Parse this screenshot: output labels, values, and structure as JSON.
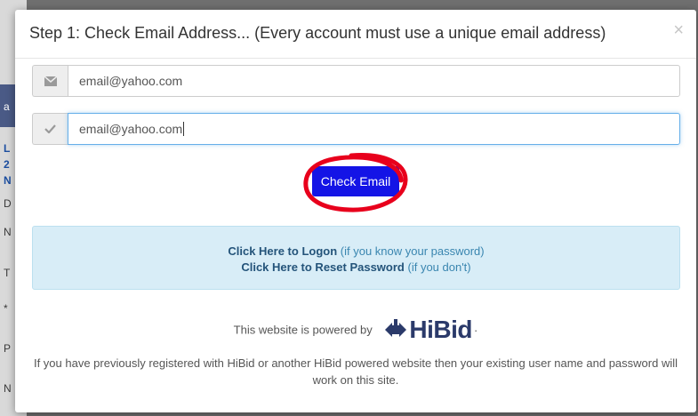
{
  "background_page": {
    "chars": [
      "a",
      "L",
      "2",
      "N",
      "D",
      "N",
      "T",
      "*",
      "P",
      "N"
    ]
  },
  "modal": {
    "title": "Step 1: Check Email Address... (Every account must use a unique email address)",
    "close_glyph": "×",
    "email_field": {
      "value": "email@yahoo.com",
      "icon": "envelope-icon"
    },
    "confirm_field": {
      "value": "email@yahoo.com",
      "icon": "check-icon"
    },
    "check_button_label": "Check Email",
    "info": {
      "logon_link": "Click Here to Logon",
      "logon_hint": "(if you know your password)",
      "reset_link": "Click Here to Reset Password",
      "reset_hint": "(if you don't)"
    },
    "powered_by": "This website is powered by",
    "brand": "HiBid",
    "footer_note": "If you have previously registered with HiBid or another HiBid powered website then your existing user name and password will work on this site."
  },
  "colors": {
    "button_bg": "#1414e6",
    "annotation_circle": "#e8001c",
    "info_bg": "#d8edf7",
    "brand": "#2b3a6a"
  }
}
